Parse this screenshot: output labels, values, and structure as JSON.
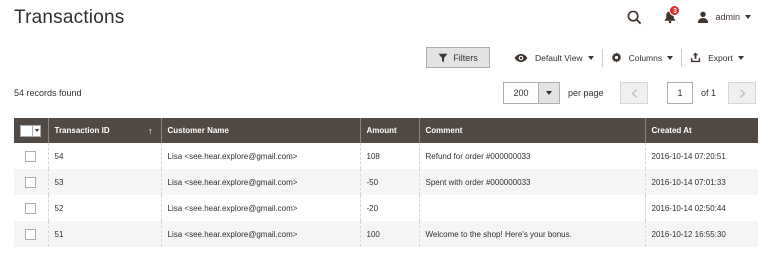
{
  "page": {
    "title": "Transactions"
  },
  "header": {
    "notifications_count": "3",
    "admin_label": "admin"
  },
  "toolbar": {
    "filters_label": "Filters",
    "view_label": "Default View",
    "columns_label": "Columns",
    "export_label": "Export"
  },
  "grid_meta": {
    "records_found": "54 records found",
    "per_page_value": "200",
    "per_page_label": "per page",
    "current_page": "1",
    "of_pages": "of 1"
  },
  "table": {
    "columns": [
      "Transaction ID",
      "Customer Name",
      "Amount",
      "Comment",
      "Created At"
    ],
    "sort_indicator": "↑",
    "rows": [
      {
        "id": "54",
        "customer": "Lisa <see.hear.explore@gmail.com>",
        "amount": "108",
        "sign": "pos",
        "comment": "Refund for order #000000033",
        "created": "2016-10-14 07:20:51"
      },
      {
        "id": "53",
        "customer": "Lisa <see.hear.explore@gmail.com>",
        "amount": "-50",
        "sign": "neg",
        "comment": "Spent with order #000000033",
        "created": "2016-10-14 07:01:33"
      },
      {
        "id": "52",
        "customer": "Lisa <see.hear.explore@gmail.com>",
        "amount": "-20",
        "sign": "neg",
        "comment": "",
        "created": "2016-10-14 02:50:44"
      },
      {
        "id": "51",
        "customer": "Lisa <see.hear.explore@gmail.com>",
        "amount": "100",
        "sign": "pos",
        "comment": "Welcome to the shop! Here's your bonus.",
        "created": "2016-10-12 16:55:30"
      }
    ]
  },
  "icons": {
    "search": "search-icon",
    "notifications": "bell-icon",
    "user": "user-icon",
    "filter": "funnel-icon",
    "view": "eye-icon",
    "columns": "gear-icon",
    "export": "export-icon"
  },
  "colors": {
    "header_bg": "#514943",
    "positive_amount": "#3e8c16",
    "negative_amount": "#e22626",
    "notification_badge": "#e22626"
  }
}
